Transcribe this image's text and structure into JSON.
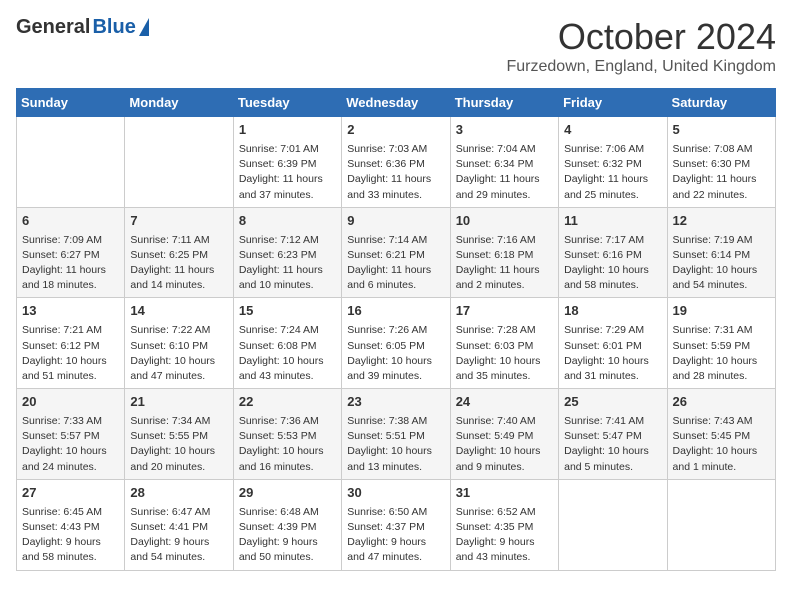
{
  "header": {
    "logo_general": "General",
    "logo_blue": "Blue",
    "title": "October 2024",
    "location": "Furzedown, England, United Kingdom"
  },
  "days_of_week": [
    "Sunday",
    "Monday",
    "Tuesday",
    "Wednesday",
    "Thursday",
    "Friday",
    "Saturday"
  ],
  "weeks": [
    [
      {
        "day": "",
        "content": ""
      },
      {
        "day": "",
        "content": ""
      },
      {
        "day": "1",
        "content": "Sunrise: 7:01 AM\nSunset: 6:39 PM\nDaylight: 11 hours and 37 minutes."
      },
      {
        "day": "2",
        "content": "Sunrise: 7:03 AM\nSunset: 6:36 PM\nDaylight: 11 hours and 33 minutes."
      },
      {
        "day": "3",
        "content": "Sunrise: 7:04 AM\nSunset: 6:34 PM\nDaylight: 11 hours and 29 minutes."
      },
      {
        "day": "4",
        "content": "Sunrise: 7:06 AM\nSunset: 6:32 PM\nDaylight: 11 hours and 25 minutes."
      },
      {
        "day": "5",
        "content": "Sunrise: 7:08 AM\nSunset: 6:30 PM\nDaylight: 11 hours and 22 minutes."
      }
    ],
    [
      {
        "day": "6",
        "content": "Sunrise: 7:09 AM\nSunset: 6:27 PM\nDaylight: 11 hours and 18 minutes."
      },
      {
        "day": "7",
        "content": "Sunrise: 7:11 AM\nSunset: 6:25 PM\nDaylight: 11 hours and 14 minutes."
      },
      {
        "day": "8",
        "content": "Sunrise: 7:12 AM\nSunset: 6:23 PM\nDaylight: 11 hours and 10 minutes."
      },
      {
        "day": "9",
        "content": "Sunrise: 7:14 AM\nSunset: 6:21 PM\nDaylight: 11 hours and 6 minutes."
      },
      {
        "day": "10",
        "content": "Sunrise: 7:16 AM\nSunset: 6:18 PM\nDaylight: 11 hours and 2 minutes."
      },
      {
        "day": "11",
        "content": "Sunrise: 7:17 AM\nSunset: 6:16 PM\nDaylight: 10 hours and 58 minutes."
      },
      {
        "day": "12",
        "content": "Sunrise: 7:19 AM\nSunset: 6:14 PM\nDaylight: 10 hours and 54 minutes."
      }
    ],
    [
      {
        "day": "13",
        "content": "Sunrise: 7:21 AM\nSunset: 6:12 PM\nDaylight: 10 hours and 51 minutes."
      },
      {
        "day": "14",
        "content": "Sunrise: 7:22 AM\nSunset: 6:10 PM\nDaylight: 10 hours and 47 minutes."
      },
      {
        "day": "15",
        "content": "Sunrise: 7:24 AM\nSunset: 6:08 PM\nDaylight: 10 hours and 43 minutes."
      },
      {
        "day": "16",
        "content": "Sunrise: 7:26 AM\nSunset: 6:05 PM\nDaylight: 10 hours and 39 minutes."
      },
      {
        "day": "17",
        "content": "Sunrise: 7:28 AM\nSunset: 6:03 PM\nDaylight: 10 hours and 35 minutes."
      },
      {
        "day": "18",
        "content": "Sunrise: 7:29 AM\nSunset: 6:01 PM\nDaylight: 10 hours and 31 minutes."
      },
      {
        "day": "19",
        "content": "Sunrise: 7:31 AM\nSunset: 5:59 PM\nDaylight: 10 hours and 28 minutes."
      }
    ],
    [
      {
        "day": "20",
        "content": "Sunrise: 7:33 AM\nSunset: 5:57 PM\nDaylight: 10 hours and 24 minutes."
      },
      {
        "day": "21",
        "content": "Sunrise: 7:34 AM\nSunset: 5:55 PM\nDaylight: 10 hours and 20 minutes."
      },
      {
        "day": "22",
        "content": "Sunrise: 7:36 AM\nSunset: 5:53 PM\nDaylight: 10 hours and 16 minutes."
      },
      {
        "day": "23",
        "content": "Sunrise: 7:38 AM\nSunset: 5:51 PM\nDaylight: 10 hours and 13 minutes."
      },
      {
        "day": "24",
        "content": "Sunrise: 7:40 AM\nSunset: 5:49 PM\nDaylight: 10 hours and 9 minutes."
      },
      {
        "day": "25",
        "content": "Sunrise: 7:41 AM\nSunset: 5:47 PM\nDaylight: 10 hours and 5 minutes."
      },
      {
        "day": "26",
        "content": "Sunrise: 7:43 AM\nSunset: 5:45 PM\nDaylight: 10 hours and 1 minute."
      }
    ],
    [
      {
        "day": "27",
        "content": "Sunrise: 6:45 AM\nSunset: 4:43 PM\nDaylight: 9 hours and 58 minutes."
      },
      {
        "day": "28",
        "content": "Sunrise: 6:47 AM\nSunset: 4:41 PM\nDaylight: 9 hours and 54 minutes."
      },
      {
        "day": "29",
        "content": "Sunrise: 6:48 AM\nSunset: 4:39 PM\nDaylight: 9 hours and 50 minutes."
      },
      {
        "day": "30",
        "content": "Sunrise: 6:50 AM\nSunset: 4:37 PM\nDaylight: 9 hours and 47 minutes."
      },
      {
        "day": "31",
        "content": "Sunrise: 6:52 AM\nSunset: 4:35 PM\nDaylight: 9 hours and 43 minutes."
      },
      {
        "day": "",
        "content": ""
      },
      {
        "day": "",
        "content": ""
      }
    ]
  ]
}
